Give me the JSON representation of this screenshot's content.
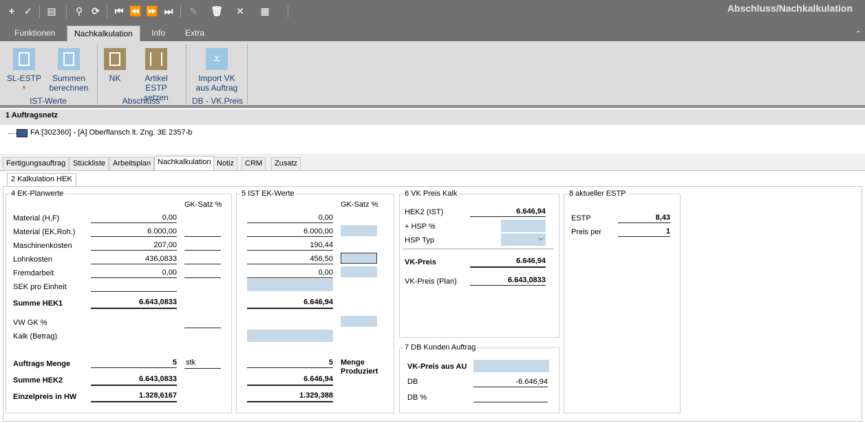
{
  "app": {
    "title": "Abschluss/Nachkalkulation"
  },
  "toolbar": {
    "icons": [
      "add-icon",
      "check-icon",
      "print-icon",
      "search-icon",
      "refresh-icon",
      "first-icon",
      "prev-icon",
      "next-icon",
      "last-icon",
      "edit-icon",
      "delete-icon",
      "close-icon",
      "grid-icon"
    ]
  },
  "menu_tabs": [
    "Funktionen",
    "Nachkalkulation",
    "Info",
    "Extra"
  ],
  "ribbon": {
    "sl_estp": "SL-ESTP",
    "summen_1": "Summen",
    "summen_2": "berechnen",
    "nk": "NK",
    "artikel_1": "Artikel",
    "artikel_2": "ESTP setzen",
    "import_1": "Import VK",
    "import_2": "aus Auftrag",
    "group_ist": "IST-Werte",
    "group_abschluss": "Abschluss",
    "group_db": "DB - VK.Preis"
  },
  "auftragsnetz": {
    "title": "1 Auftragsnetz",
    "item": "FA:[302360] - [A] Oberflansch lt. Zng. 3E 2357-b"
  },
  "tabs": [
    "Fertigungsauftrag",
    "Stückliste",
    "Arbeitsplan",
    "Nachkalkulation",
    "Notiz",
    "CRM",
    "Zusatz"
  ],
  "subtab": "2 Kalkulation HEK",
  "ek_plan": {
    "title": "4 EK-Planwerte",
    "gk_header": "GK-Satz %",
    "rows": [
      {
        "label": "Material (H,F)",
        "value": "0,00"
      },
      {
        "label": "Material (EK,Roh.)",
        "value": "6.000,00"
      },
      {
        "label": "Maschinenkosten",
        "value": "207,00"
      },
      {
        "label": "Lohnkosten",
        "value": "436,0833"
      },
      {
        "label": "Fremdarbeit",
        "value": "0,00"
      },
      {
        "label": "SEK pro Einheit",
        "value": ""
      }
    ],
    "summe_hek1_label": "Summe HEK1",
    "summe_hek1": "6.643,0833",
    "vwgk_label": "VW GK %",
    "kalk_label": "Kalk (Betrag)",
    "menge_label": "Auftrags Menge",
    "menge": "5",
    "unit": "stk",
    "summe_hek2_label": "Summe HEK2",
    "summe_hek2": "6.643,0833",
    "einzelpreis_label": "Einzelpreis in HW",
    "einzelpreis": "1.328,6167"
  },
  "ist_ek": {
    "title": "5 IST EK-Werte",
    "gk_header": "GK-Satz %",
    "values": [
      "0,00",
      "6.000,00",
      "190,44",
      "456,50",
      "0,00"
    ],
    "summe_hek1": "6.646,94",
    "menge": "5",
    "menge_label_1": "Menge",
    "menge_label_2": "Produziert",
    "summe_hek2": "6.646,94",
    "einzelpreis": "1.329,388"
  },
  "vk_kalk": {
    "title": "6 VK Preis Kalk",
    "hek2_label": "HEK2 (IST)",
    "hek2": "6.646,94",
    "hsp_label": "+ HSP %",
    "hsp_typ_label": "HSP Typ",
    "vk_label": "VK-Preis",
    "vk": "6.646,94",
    "vk_plan_label": "VK-Preis (Plan)",
    "vk_plan": "6.643,0833"
  },
  "db_kunden": {
    "title": "7 DB Kunden Auftrag",
    "vk_au_label": "VK-Preis aus AU",
    "db_label": "DB",
    "db": "-6.646,94",
    "db_pct_label": "DB %"
  },
  "estp": {
    "title": "8 aktueller ESTP",
    "estp_label": "ESTP",
    "estp": "8,43",
    "preis_per_label": "Preis per",
    "preis_per": "1"
  }
}
